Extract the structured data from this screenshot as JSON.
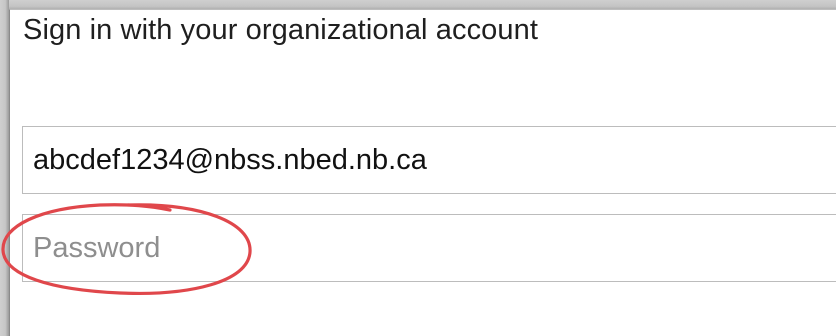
{
  "form": {
    "heading": "Sign in with your organizational account",
    "username_value": "abcdef1234@nbss.nbed.nb.ca",
    "password_placeholder": "Password",
    "password_value": ""
  },
  "annotation": {
    "shape": "ellipse",
    "target": "password-field",
    "color": "#e0474b"
  }
}
